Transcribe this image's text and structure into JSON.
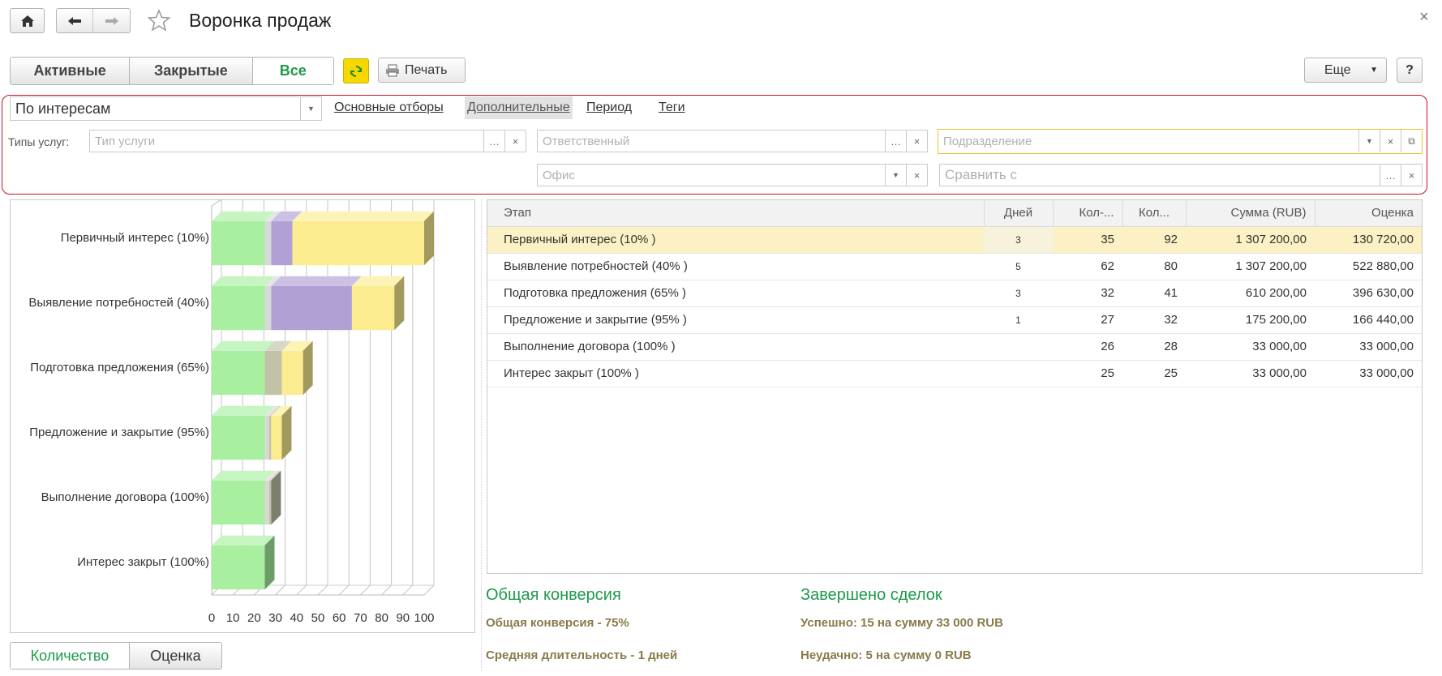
{
  "window": {
    "title": "Воронка продаж",
    "close_label": "×"
  },
  "toolbar": {
    "filters": [
      "Активные",
      "Закрытые",
      "Все"
    ],
    "active_filter": "Все",
    "print_label": "Печать",
    "more_label": "Еще",
    "help_label": "?"
  },
  "settings": {
    "grouping_value": "По интересам",
    "links": [
      "Основные отборы",
      "Дополнительные",
      "Период",
      "Теги"
    ],
    "active_link": "Дополнительные",
    "service_types_label": "Типы услуг:",
    "service_type_placeholder": "Тип услуги",
    "responsible_placeholder": "Ответственный",
    "department_placeholder": "Подразделение",
    "office_placeholder": "Офис",
    "compare_placeholder": "Сравнить с"
  },
  "chart_data": {
    "type": "bar",
    "orientation": "horizontal",
    "stacked": true,
    "categories": [
      "Первичный интерес (10%)",
      "Выявление потребностей (40%)",
      "Подготовка предложения (65%)",
      "Предложение и закрытие (95%)",
      "Выполнение договора (100%)",
      "Интерес закрыт (100%)"
    ],
    "series": [
      {
        "color": "#a8f0a0",
        "values": [
          25,
          25,
          25,
          25,
          25,
          25
        ]
      },
      {
        "color": "#d8d8d8",
        "values": [
          3,
          3,
          0,
          2,
          2,
          0
        ]
      },
      {
        "color": "#c2c2a8",
        "values": [
          0,
          0,
          8,
          1,
          1,
          0
        ]
      },
      {
        "color": "#b0a0d4",
        "values": [
          10,
          38,
          0,
          0,
          0,
          0
        ]
      },
      {
        "color": "#fbec90",
        "values": [
          62,
          20,
          10,
          5,
          0,
          0
        ]
      }
    ],
    "xticks": [
      "0",
      "10",
      "20",
      "30",
      "40",
      "50",
      "60",
      "70",
      "80",
      "90",
      "100"
    ],
    "xlim": [
      0,
      100
    ],
    "grid": true
  },
  "chart_toggle": {
    "options": [
      "Количество",
      "Оценка"
    ],
    "active": "Количество"
  },
  "table": {
    "columns": [
      "Этап",
      "Дней",
      "Кол-...",
      "Кол...",
      "Сумма (RUB)",
      "Оценка"
    ],
    "rows": [
      {
        "stage": "Первичный интерес (10% )",
        "days": "3",
        "count1": "35",
        "count2": "92",
        "sum": "1 307 200,00",
        "est": "130 720,00"
      },
      {
        "stage": "Выявление потребностей (40% )",
        "days": "5",
        "count1": "62",
        "count2": "80",
        "sum": "1 307 200,00",
        "est": "522 880,00"
      },
      {
        "stage": "Подготовка предложения (65% )",
        "days": "3",
        "count1": "32",
        "count2": "41",
        "sum": "610 200,00",
        "est": "396 630,00"
      },
      {
        "stage": "Предложение и закрытие (95% )",
        "days": "1",
        "count1": "27",
        "count2": "32",
        "sum": "175 200,00",
        "est": "166 440,00"
      },
      {
        "stage": "Выполнение договора (100% )",
        "days": "",
        "count1": "26",
        "count2": "28",
        "sum": "33 000,00",
        "est": "33 000,00"
      },
      {
        "stage": "Интерес закрыт (100% )",
        "days": "",
        "count1": "25",
        "count2": "25",
        "sum": "33 000,00",
        "est": "33 000,00"
      }
    ]
  },
  "summary": {
    "conversion_title": "Общая конверсия",
    "conversion_text": "Общая конверсия - 75%",
    "duration_text": "Средняя длительность - 1 дней",
    "deals_title": "Завершено сделок",
    "success_text": "Успешно: 15 на сумму 33 000 RUB",
    "fail_text": "Неудачно: 5 на сумму 0 RUB"
  },
  "colors": {
    "accent_green": "#1c9a4a",
    "highlight_border": "#c8102e",
    "refresh_yellow": "#f5d800",
    "summary_text": "#8a7a4a"
  }
}
